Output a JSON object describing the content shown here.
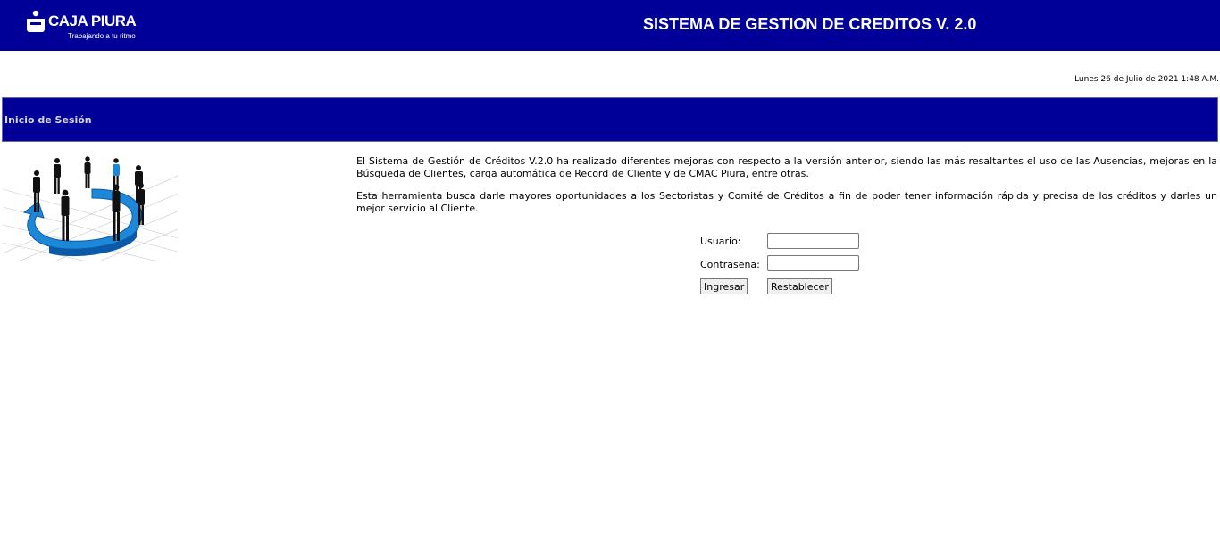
{
  "header": {
    "brand_name": "CAJA PIURA",
    "brand_slogan": "Trabajando a tu ritmo",
    "app_title": "SISTEMA DE GESTION DE CREDITOS V. 2.0"
  },
  "datetime": "Lunes 26 de Julio de 2021 1:48 A.M.",
  "section": {
    "title": "Inicio de Sesión"
  },
  "intro": {
    "paragraph1": "El Sistema de Gestión de Créditos V.2.0 ha realizado diferentes mejoras con respecto a la versión anterior, siendo las más resaltantes el uso de las Ausencias, mejoras en la Búsqueda de Clientes, carga automática de Record de Cliente y de CMAC Piura, entre otras.",
    "paragraph2": "Esta herramienta busca darle mayores oportunidades a los Sectoristas y Comité de Créditos a fin de poder tener información rápida y precisa de los créditos y darles un mejor servicio al Cliente."
  },
  "login": {
    "user_label": "Usuario:",
    "user_value": "",
    "password_label": "Contraseña:",
    "password_value": "",
    "submit_label": "Ingresar",
    "reset_label": "Restablecer"
  },
  "colors": {
    "brand_blue": "#000099",
    "illustration_blue": "#1e88d8"
  },
  "icons": {
    "logo": "caja-piura-logo-icon",
    "illustration": "business-team-ring-illustration"
  }
}
